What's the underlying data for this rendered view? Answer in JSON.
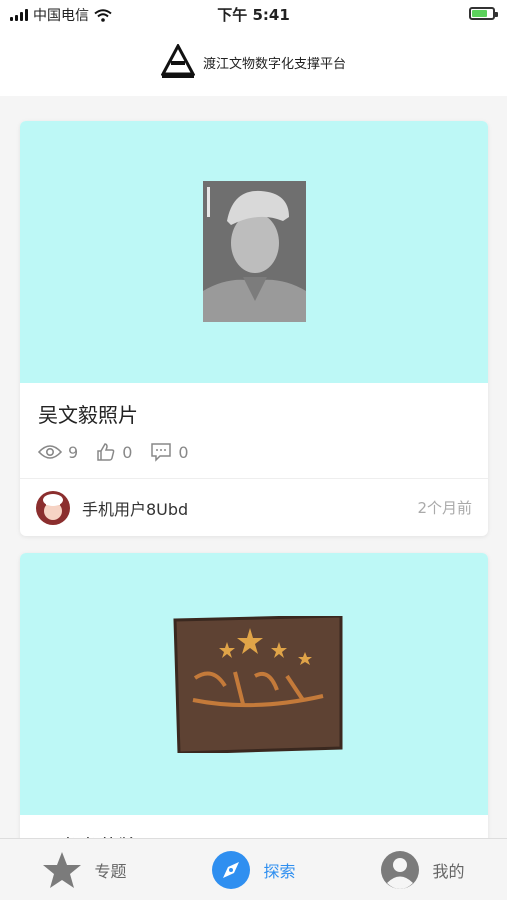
{
  "status_bar": {
    "carrier": "中国电信",
    "time": "下午 5:41",
    "battery_level": 0.7
  },
  "header": {
    "title": "渡江文物数字化支撑平台"
  },
  "cards": [
    {
      "title": "吴文毅照片",
      "views": "9",
      "likes": "0",
      "comments": "0",
      "author": "手机用户8Ubd",
      "time": "2个月前",
      "image_icon": "portrait-photo"
    },
    {
      "title": "王光光荣牌",
      "image_icon": "honor-plaque"
    }
  ],
  "tabbar": {
    "tabs": [
      {
        "label": "专题",
        "icon": "star-icon"
      },
      {
        "label": "探索",
        "icon": "compass-icon",
        "active": true
      },
      {
        "label": "我的",
        "icon": "user-icon"
      }
    ]
  },
  "colors": {
    "accent": "#2f8ff0",
    "card_media_bg": "#bdf8f6"
  }
}
